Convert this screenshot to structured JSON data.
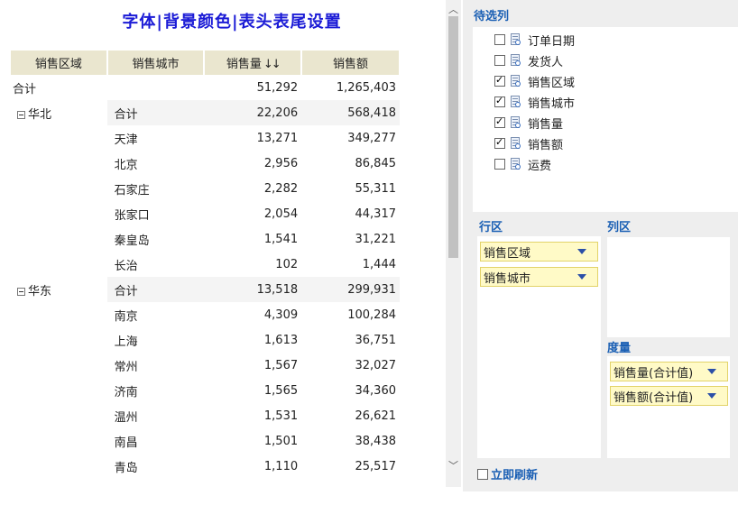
{
  "report": {
    "title": "字体|背景颜色|表头表尾设置",
    "columns": [
      "销售区域",
      "销售城市",
      "销售量",
      "销售额"
    ],
    "sort_indicator": "↓↓",
    "total_row": {
      "label": "合计",
      "qty": "51,292",
      "amount": "1,265,403"
    },
    "rows": [
      {
        "region": "华北",
        "city": "合计",
        "qty": "22,206",
        "amount": "568,418"
      },
      {
        "region": "",
        "city": "天津",
        "qty": "13,271",
        "amount": "349,277"
      },
      {
        "region": "",
        "city": "北京",
        "qty": "2,956",
        "amount": "86,845"
      },
      {
        "region": "",
        "city": "石家庄",
        "qty": "2,282",
        "amount": "55,311"
      },
      {
        "region": "",
        "city": "张家口",
        "qty": "2,054",
        "amount": "44,317"
      },
      {
        "region": "",
        "city": "秦皇岛",
        "qty": "1,541",
        "amount": "31,221"
      },
      {
        "region": "",
        "city": "长治",
        "qty": "102",
        "amount": "1,444"
      },
      {
        "region": "华东",
        "city": "合计",
        "qty": "13,518",
        "amount": "299,931"
      },
      {
        "region": "",
        "city": "南京",
        "qty": "4,309",
        "amount": "100,284"
      },
      {
        "region": "",
        "city": "上海",
        "qty": "1,613",
        "amount": "36,751"
      },
      {
        "region": "",
        "city": "常州",
        "qty": "1,567",
        "amount": "32,027"
      },
      {
        "region": "",
        "city": "济南",
        "qty": "1,565",
        "amount": "34,360"
      },
      {
        "region": "",
        "city": "温州",
        "qty": "1,531",
        "amount": "26,621"
      },
      {
        "region": "",
        "city": "南昌",
        "qty": "1,501",
        "amount": "38,438"
      },
      {
        "region": "",
        "city": "青岛",
        "qty": "1,110",
        "amount": "25,517"
      }
    ]
  },
  "panel": {
    "fields_title": "待选列",
    "fields": [
      {
        "label": "订单日期",
        "checked": false
      },
      {
        "label": "发货人",
        "checked": false
      },
      {
        "label": "销售区域",
        "checked": true
      },
      {
        "label": "销售城市",
        "checked": true
      },
      {
        "label": "销售量",
        "checked": true
      },
      {
        "label": "销售额",
        "checked": true
      },
      {
        "label": "运费",
        "checked": false
      }
    ],
    "row_zone_title": "行区",
    "row_zone_items": [
      "销售区域",
      "销售城市"
    ],
    "col_zone_title": "列区",
    "measure_zone_title": "度量",
    "measure_items": [
      "销售量(合计值)",
      "销售额(合计值)"
    ],
    "refresh_label": "立即刷新"
  },
  "colors": {
    "title": "#1b1bd6",
    "header_bg": "#eae6cf",
    "panel_label": "#1a5fb4",
    "pill_bg": "#fffac7"
  }
}
